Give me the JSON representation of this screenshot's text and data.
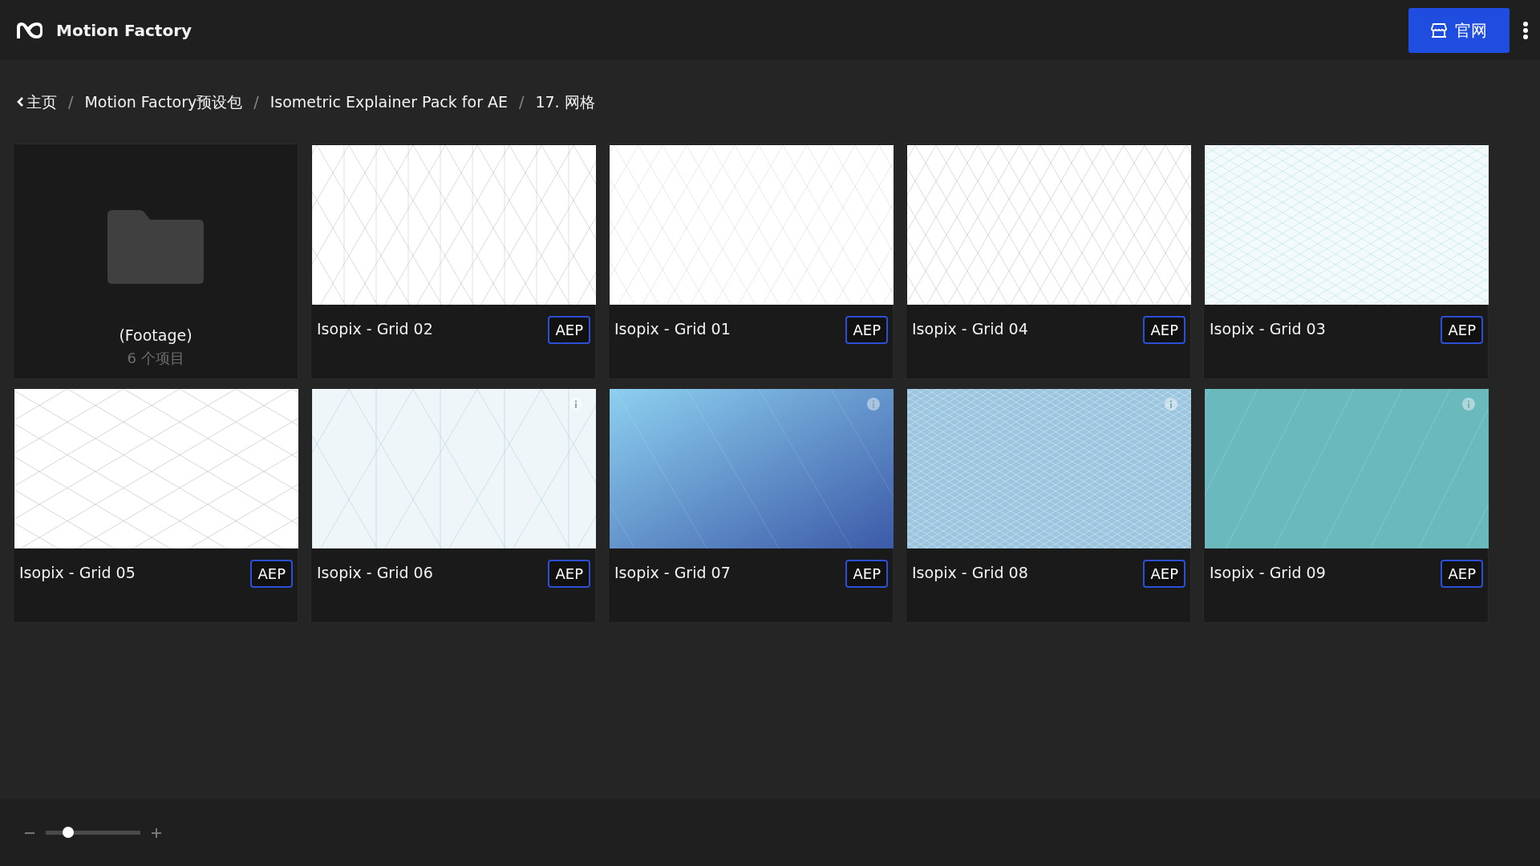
{
  "app": {
    "title": "Motion Factory",
    "site_button": "官网"
  },
  "breadcrumb": [
    {
      "label": "主页",
      "back": true
    },
    {
      "label": "Motion Factory预设包",
      "back": false,
      "separator": "/"
    },
    {
      "label": "Isometric Explainer Pack for AE",
      "back": false,
      "separator": "/"
    },
    {
      "label": "17. 网格",
      "back": false,
      "separator": "/"
    }
  ],
  "items": [
    {
      "kind": "folder",
      "name": "(Footage)",
      "count": "6 个项目"
    },
    {
      "kind": "file",
      "name": "Isopix - Grid 02",
      "badge": "AEP",
      "info": false
    },
    {
      "kind": "file",
      "name": "Isopix - Grid 01",
      "badge": "AEP",
      "info": false
    },
    {
      "kind": "file",
      "name": "Isopix - Grid 04",
      "badge": "AEP",
      "info": false
    },
    {
      "kind": "file",
      "name": "Isopix - Grid 03",
      "badge": "AEP",
      "info": false
    },
    {
      "kind": "file",
      "name": "Isopix - Grid 05",
      "badge": "AEP",
      "info": false
    },
    {
      "kind": "file",
      "name": "Isopix - Grid 06",
      "badge": "AEP",
      "info": true
    },
    {
      "kind": "file",
      "name": "Isopix - Grid 07",
      "badge": "AEP",
      "info": true
    },
    {
      "kind": "file",
      "name": "Isopix - Grid 08",
      "badge": "AEP",
      "info": true
    },
    {
      "kind": "file",
      "name": "Isopix - Grid 09",
      "badge": "AEP",
      "info": true
    }
  ],
  "zoom": {
    "level": 0.24
  }
}
